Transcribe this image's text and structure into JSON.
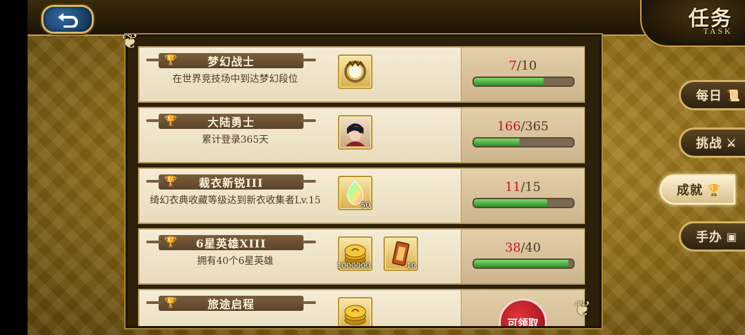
{
  "header": {
    "title": "任务",
    "subtitle": "TASK",
    "back_icon": "back-arrow-icon"
  },
  "tabs": [
    {
      "label": "每日",
      "icon": "scroll-icon",
      "active": false
    },
    {
      "label": "挑战",
      "icon": "crossed-swords-icon",
      "active": false
    },
    {
      "label": "成就",
      "icon": "trophy-icon",
      "active": true
    },
    {
      "label": "手办",
      "icon": "figure-icon",
      "active": false
    }
  ],
  "tasks": [
    {
      "title": "梦幻战士",
      "desc": "在世界竞技场中到达梦幻段位",
      "current": "7",
      "total": "10",
      "progress": 0.7,
      "rewards": [
        {
          "icon": "emblem-frame-icon",
          "count": ""
        }
      ]
    },
    {
      "title": "大陆勇士",
      "desc": "累计登录365天",
      "current": "166",
      "total": "365",
      "progress": 0.455,
      "rewards": [
        {
          "icon": "hero-portrait-icon",
          "count": ""
        }
      ]
    },
    {
      "title": "裁衣新锐III",
      "desc": "绮幻衣典收藏等级达到新衣收集者Lv.15",
      "current": "11",
      "total": "15",
      "progress": 0.733,
      "rewards": [
        {
          "icon": "rainbow-crystal-icon",
          "count": "50"
        }
      ]
    },
    {
      "title": "6星英雄XIII",
      "desc": "拥有40个6星英雄",
      "current": "38",
      "total": "40",
      "progress": 0.95,
      "rewards": [
        {
          "icon": "gold-coins-icon",
          "count": "1000000"
        },
        {
          "icon": "ticket-icon",
          "count": "10"
        }
      ]
    },
    {
      "title": "旅途启程",
      "desc": "",
      "claim": "可领取",
      "rewards": [
        {
          "icon": "gold-coins-icon",
          "count": ""
        }
      ]
    }
  ]
}
